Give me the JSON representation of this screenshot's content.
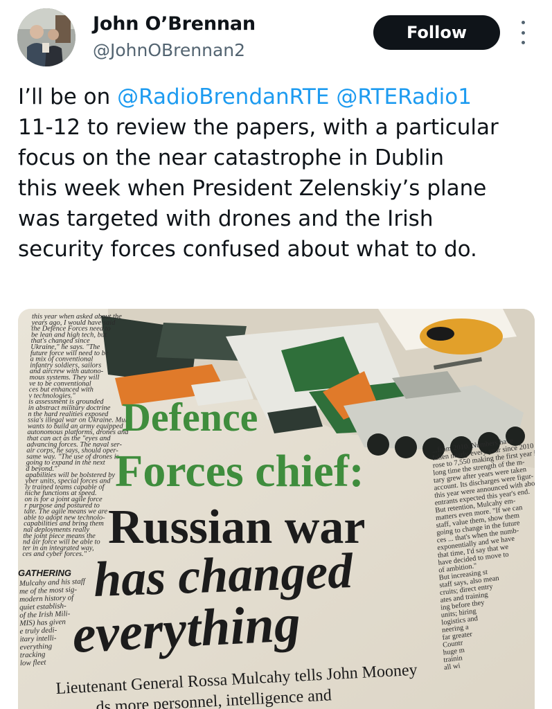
{
  "author": {
    "display_name": "John O’Brennan",
    "handle": "@JohnOBrennan2"
  },
  "actions": {
    "follow_label": "Follow",
    "more_icon": "more-vertical-icon"
  },
  "tweet": {
    "line1_prefix": "I’ll be on ",
    "mention1": "@RadioBrendanRTE",
    "line1_space": " ",
    "mention2": "@RTERadio1",
    "line2": "11-12 to review the papers, with a particular",
    "line3": "focus on the near catastrophe in Dublin",
    "line4": "this week when President Zelenskiy’s plane",
    "line5": "was targeted with drones and the Irish",
    "line6": "security forces confused about what to do."
  },
  "newspaper": {
    "headline_line1": "Defence",
    "headline_line2": "Forces chief:",
    "headline_line3": "Russian war",
    "headline_line4": "has changed",
    "headline_line5": "everything",
    "standfirst_line1": "Lieutenant General Rossa Mulcahy tells John Mooney",
    "standfirst_line2": "...ds more personnel, intelligence and",
    "side_heading": "GATHERING",
    "left_col_lines": [
      "this year when asked about the",
      "years ago, I would have said",
      "the Defence Forces need to",
      "be lean and high tech, but",
      "that's changed since",
      "Ukraine,\" he says. \"The",
      "future force will need to be",
      "a mix of conventional",
      "infantry soldiers, sailors",
      "and aircrew with autono-",
      "mous systems. They will",
      "ve to be conventional",
      "ces but enhanced with",
      "v technologies.\"",
      "is assessment is grounded",
      "in abstract military doctrine",
      "n the hard realities exposed",
      "ssia's illegal war on Ukraine. Mul-",
      "wants to build an army equipped",
      "autonomous platforms, drones and",
      "that can act as the \"eyes and",
      "advancing forces. The naval ser-",
      "air corps, he says, should oper-",
      "same way. \"The use of drones is",
      "going to expand in the next",
      "d beyond.\"",
      "apabilities will be bolstered by",
      "yber units, special forces and",
      "ly trained teams capable of",
      "niche functions at speed.",
      "on is for a joint agile force",
      "r purpose and postured to",
      "tate. The agile means we are",
      "able to adopt new technolo-",
      "capabilities and bring them",
      "nal deployments really",
      "the joint piece means the",
      "nd air force will be able to",
      "ter in an integrated way,",
      "ces and cyber forces.\""
    ],
    "left_col_lower_lines": [
      "Mulcahy and his staff",
      "me of the most sig-",
      "modern history of",
      "quiet establish-",
      "of the Irish Mili-",
      "MIS) has given",
      "e truly dedi-",
      "itary intelli-",
      "everything",
      "tracking",
      "low fleet"
    ],
    "right_col_lines": [
      "...from 2010. Numbers have",
      "fallen nearly every year since 2010 but",
      "rose to 7,550 making the first year in",
      "long time the strength of the m-",
      "tary grew after years were taken",
      "account. Its discharges were figur-",
      "this year were announced with about",
      "entrants expected this year's end.",
      "But retention, Mulcahy em-",
      "matters even more. \"If we can",
      "staff, value them, show them",
      "going to change in the future",
      "ces ... that's when the numb-",
      "exponentially and we have",
      "that time, I'd say that we",
      "have decided to move to",
      "of ambition.\"",
      "But increasing st",
      "staff says, also mean",
      "cruits; direct entry",
      "ates and training",
      "ing before they",
      "units; hiring",
      "logistics and",
      "neering a",
      "far greater",
      "Countr",
      "huge m",
      "trainin",
      "all wi"
    ]
  }
}
